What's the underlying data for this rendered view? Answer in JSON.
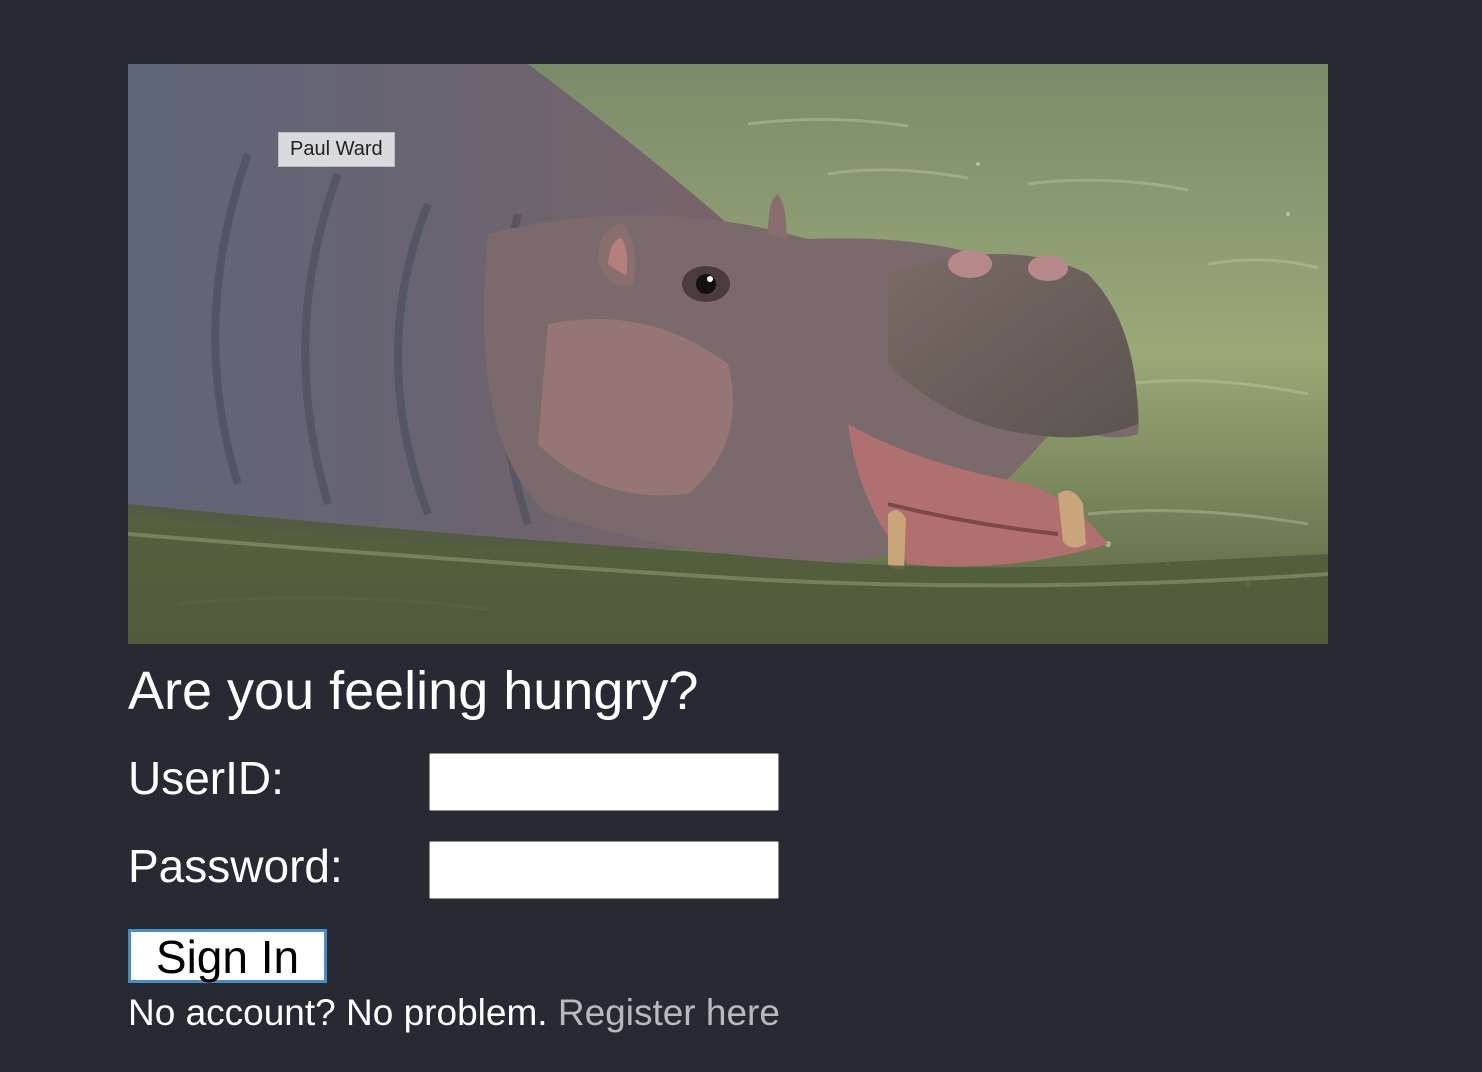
{
  "hero": {
    "photo_credit": "Paul Ward"
  },
  "heading": "Are you feeling hungry?",
  "form": {
    "userid_label": "UserID:",
    "userid_value": "",
    "password_label": "Password:",
    "password_value": "",
    "submit_label": "Sign In"
  },
  "register": {
    "prompt": "No account? No problem.",
    "link_label": "Register here"
  },
  "colors": {
    "background": "#282a33",
    "link": "#b8babe",
    "button_border": "#4a8cc2"
  }
}
